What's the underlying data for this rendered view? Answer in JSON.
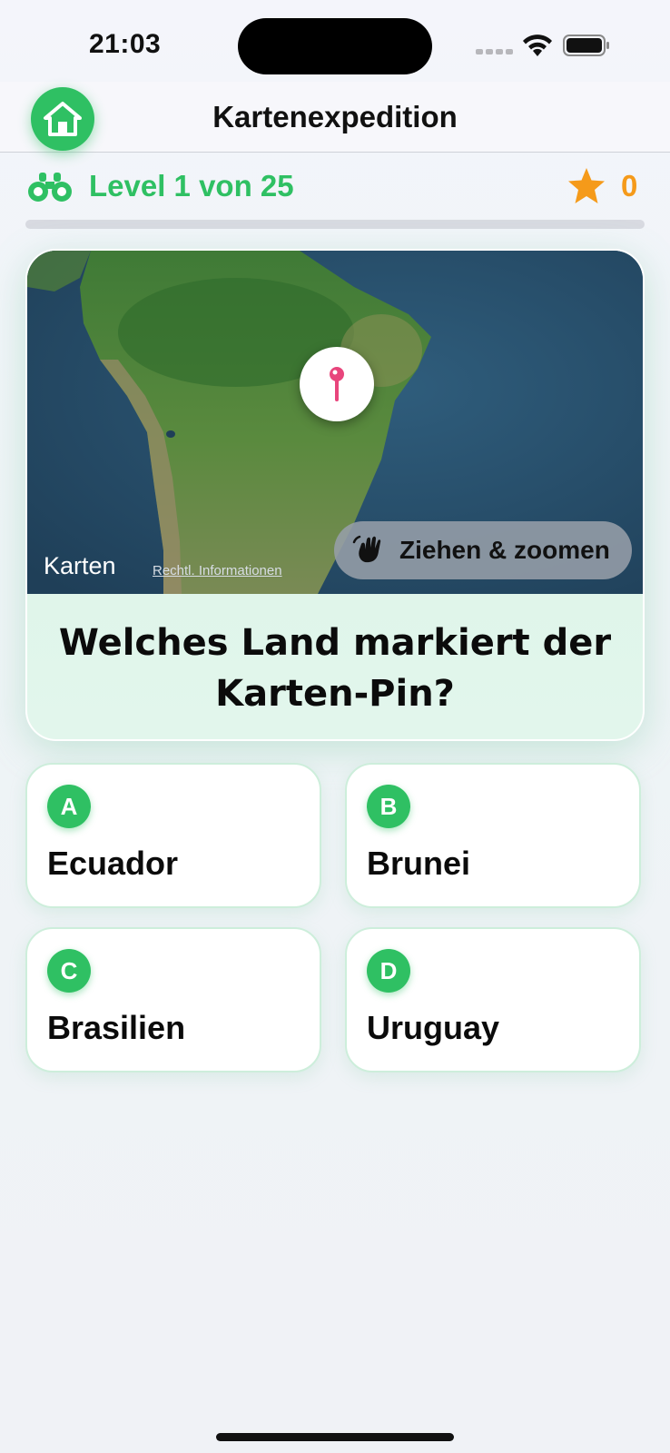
{
  "status_bar": {
    "time": "21:03"
  },
  "nav": {
    "title": "Kartenexpedition",
    "home_icon": "house-icon"
  },
  "level": {
    "text": "Level 1 von 25",
    "current": 1,
    "total": 25,
    "progress_fraction": 0.0
  },
  "score": {
    "value": "0"
  },
  "map": {
    "logo_text": "Karten",
    "legal_text": "Rechtl. Informationen",
    "drag_zoom_label": "Ziehen & zoomen"
  },
  "question": {
    "text": "Welches Land markiert der Karten-Pin?"
  },
  "answers": [
    {
      "letter": "A",
      "label": "Ecuador"
    },
    {
      "letter": "B",
      "label": "Brunei"
    },
    {
      "letter": "C",
      "label": "Brasilien"
    },
    {
      "letter": "D",
      "label": "Uruguay"
    }
  ],
  "colors": {
    "accent_green": "#2fc063",
    "star_orange": "#f59a1a",
    "pin_pink": "#e8457c"
  }
}
